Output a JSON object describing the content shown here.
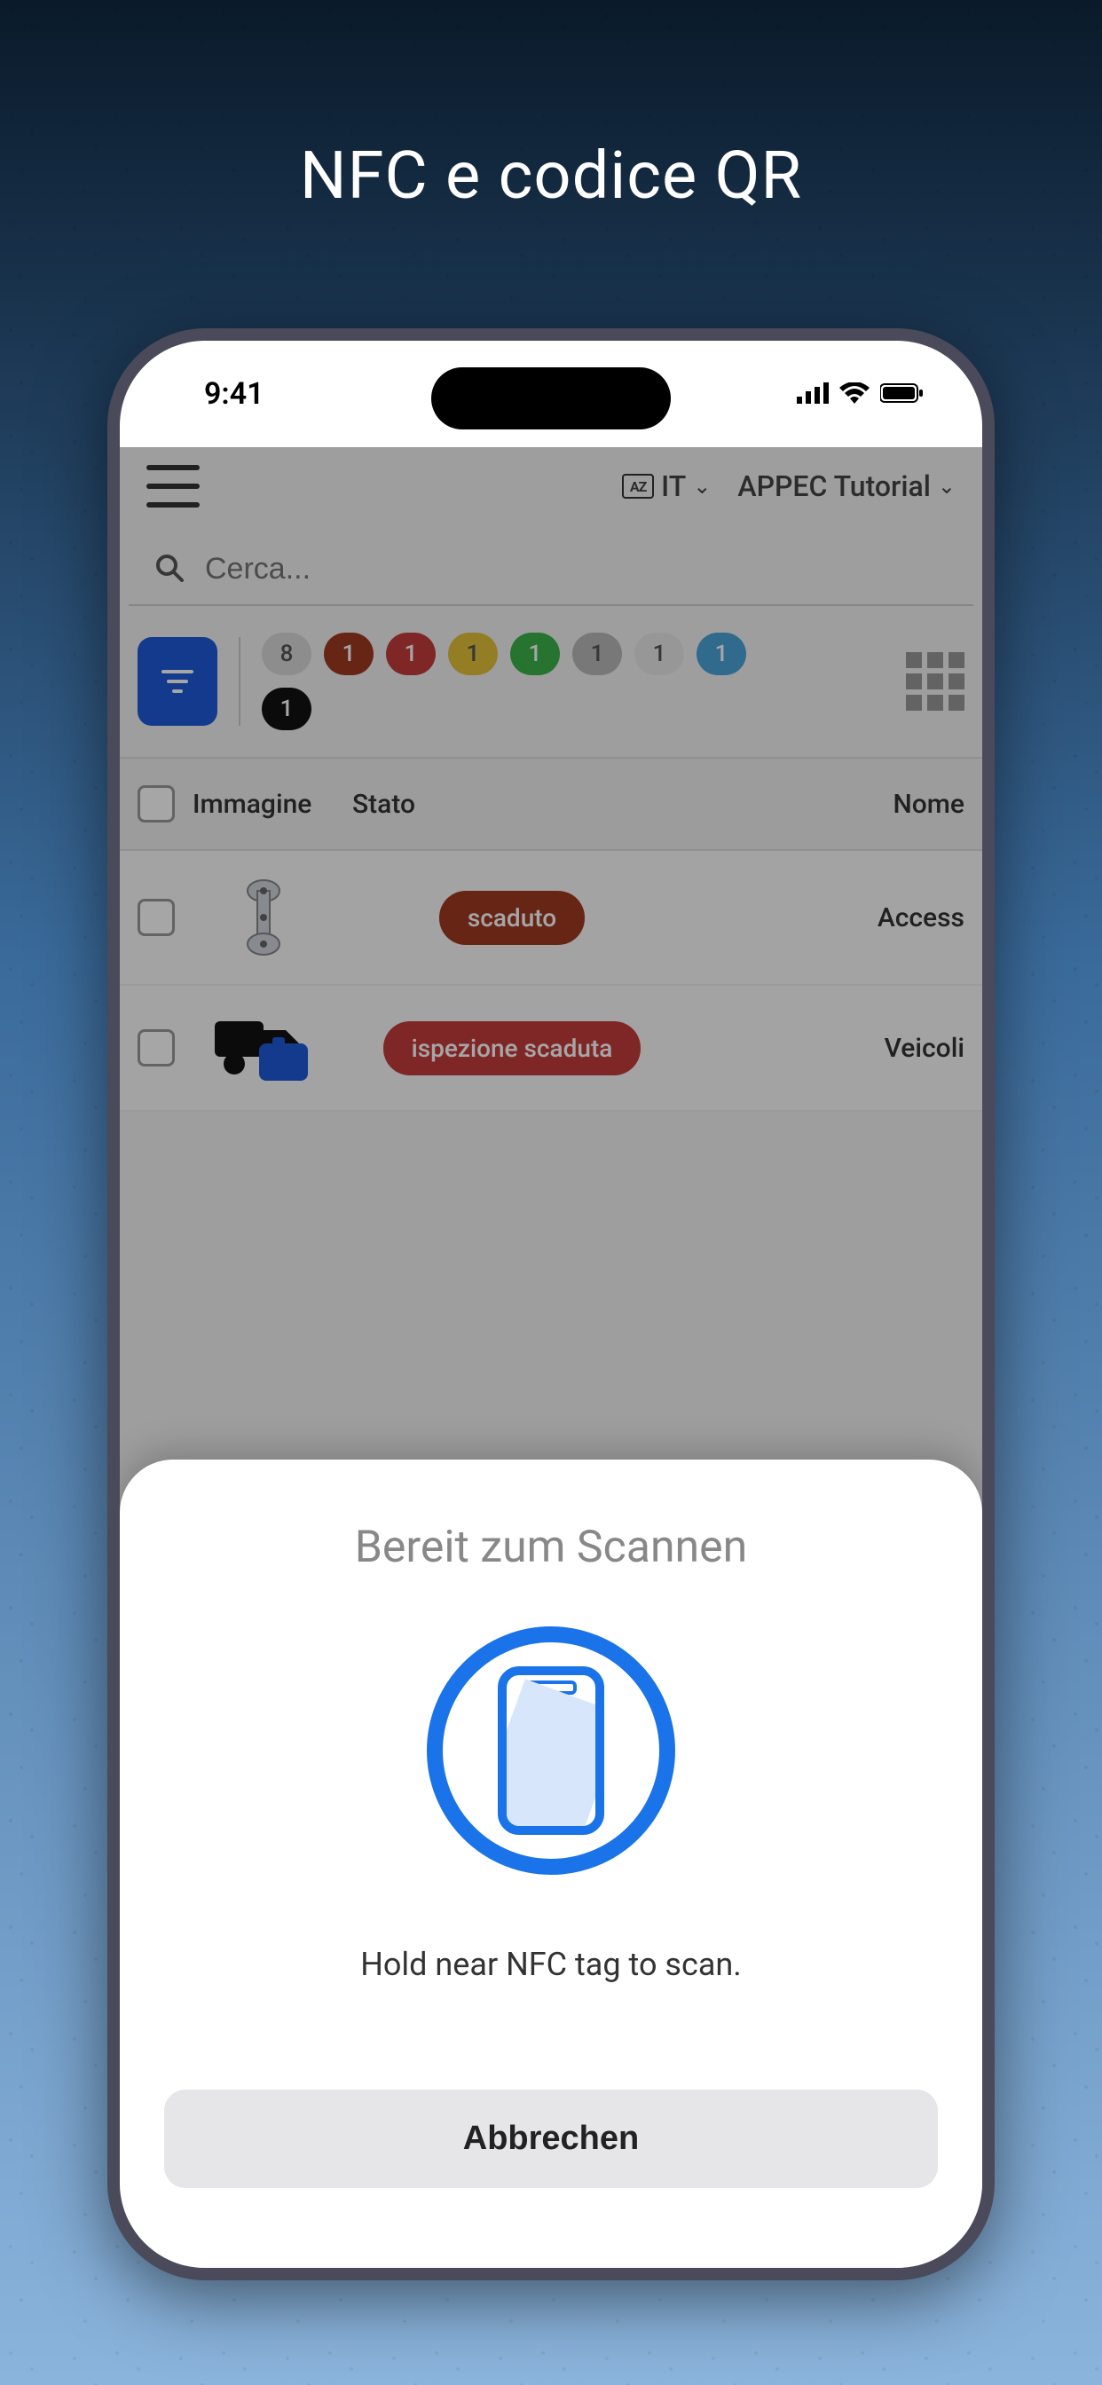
{
  "marketing_title": "NFC e codice QR",
  "status_bar": {
    "time": "9:41"
  },
  "header": {
    "lang_icon_text": "AZ",
    "lang_label": "IT",
    "tutorial_label": "APPEC Tutorial"
  },
  "search": {
    "placeholder": "Cerca..."
  },
  "filter_chips": [
    {
      "count": "8",
      "bg": "#d9d9d9",
      "fg": "#555"
    },
    {
      "count": "1",
      "bg": "#9e3a23",
      "fg": "#fff"
    },
    {
      "count": "1",
      "bg": "#c43c3c",
      "fg": "#fff"
    },
    {
      "count": "1",
      "bg": "#e2c23a",
      "fg": "#555"
    },
    {
      "count": "1",
      "bg": "#3bb24b",
      "fg": "#fff"
    },
    {
      "count": "1",
      "bg": "#b8b8b8",
      "fg": "#555"
    },
    {
      "count": "1",
      "bg": "#e8e8e8",
      "fg": "#555"
    },
    {
      "count": "1",
      "bg": "#4aa3d8",
      "fg": "#fff"
    },
    {
      "count": "1",
      "bg": "#111",
      "fg": "#fff"
    }
  ],
  "table": {
    "headers": {
      "image": "Immagine",
      "status": "Stato",
      "name": "Nome"
    },
    "rows": [
      {
        "status_label": "scaduto",
        "status_bg": "#9e3a23",
        "name": "Access",
        "icon": "connector"
      },
      {
        "status_label": "ispezione scaduta",
        "status_bg": "#c43c3c",
        "name": "Veicoli",
        "icon": "truck"
      }
    ]
  },
  "nfc_sheet": {
    "title": "Bereit zum Scannen",
    "message": "Hold near NFC tag to scan.",
    "cancel_label": "Abbrechen"
  },
  "colors": {
    "accent": "#1a73e8",
    "filter_btn": "#1f5ad9"
  }
}
